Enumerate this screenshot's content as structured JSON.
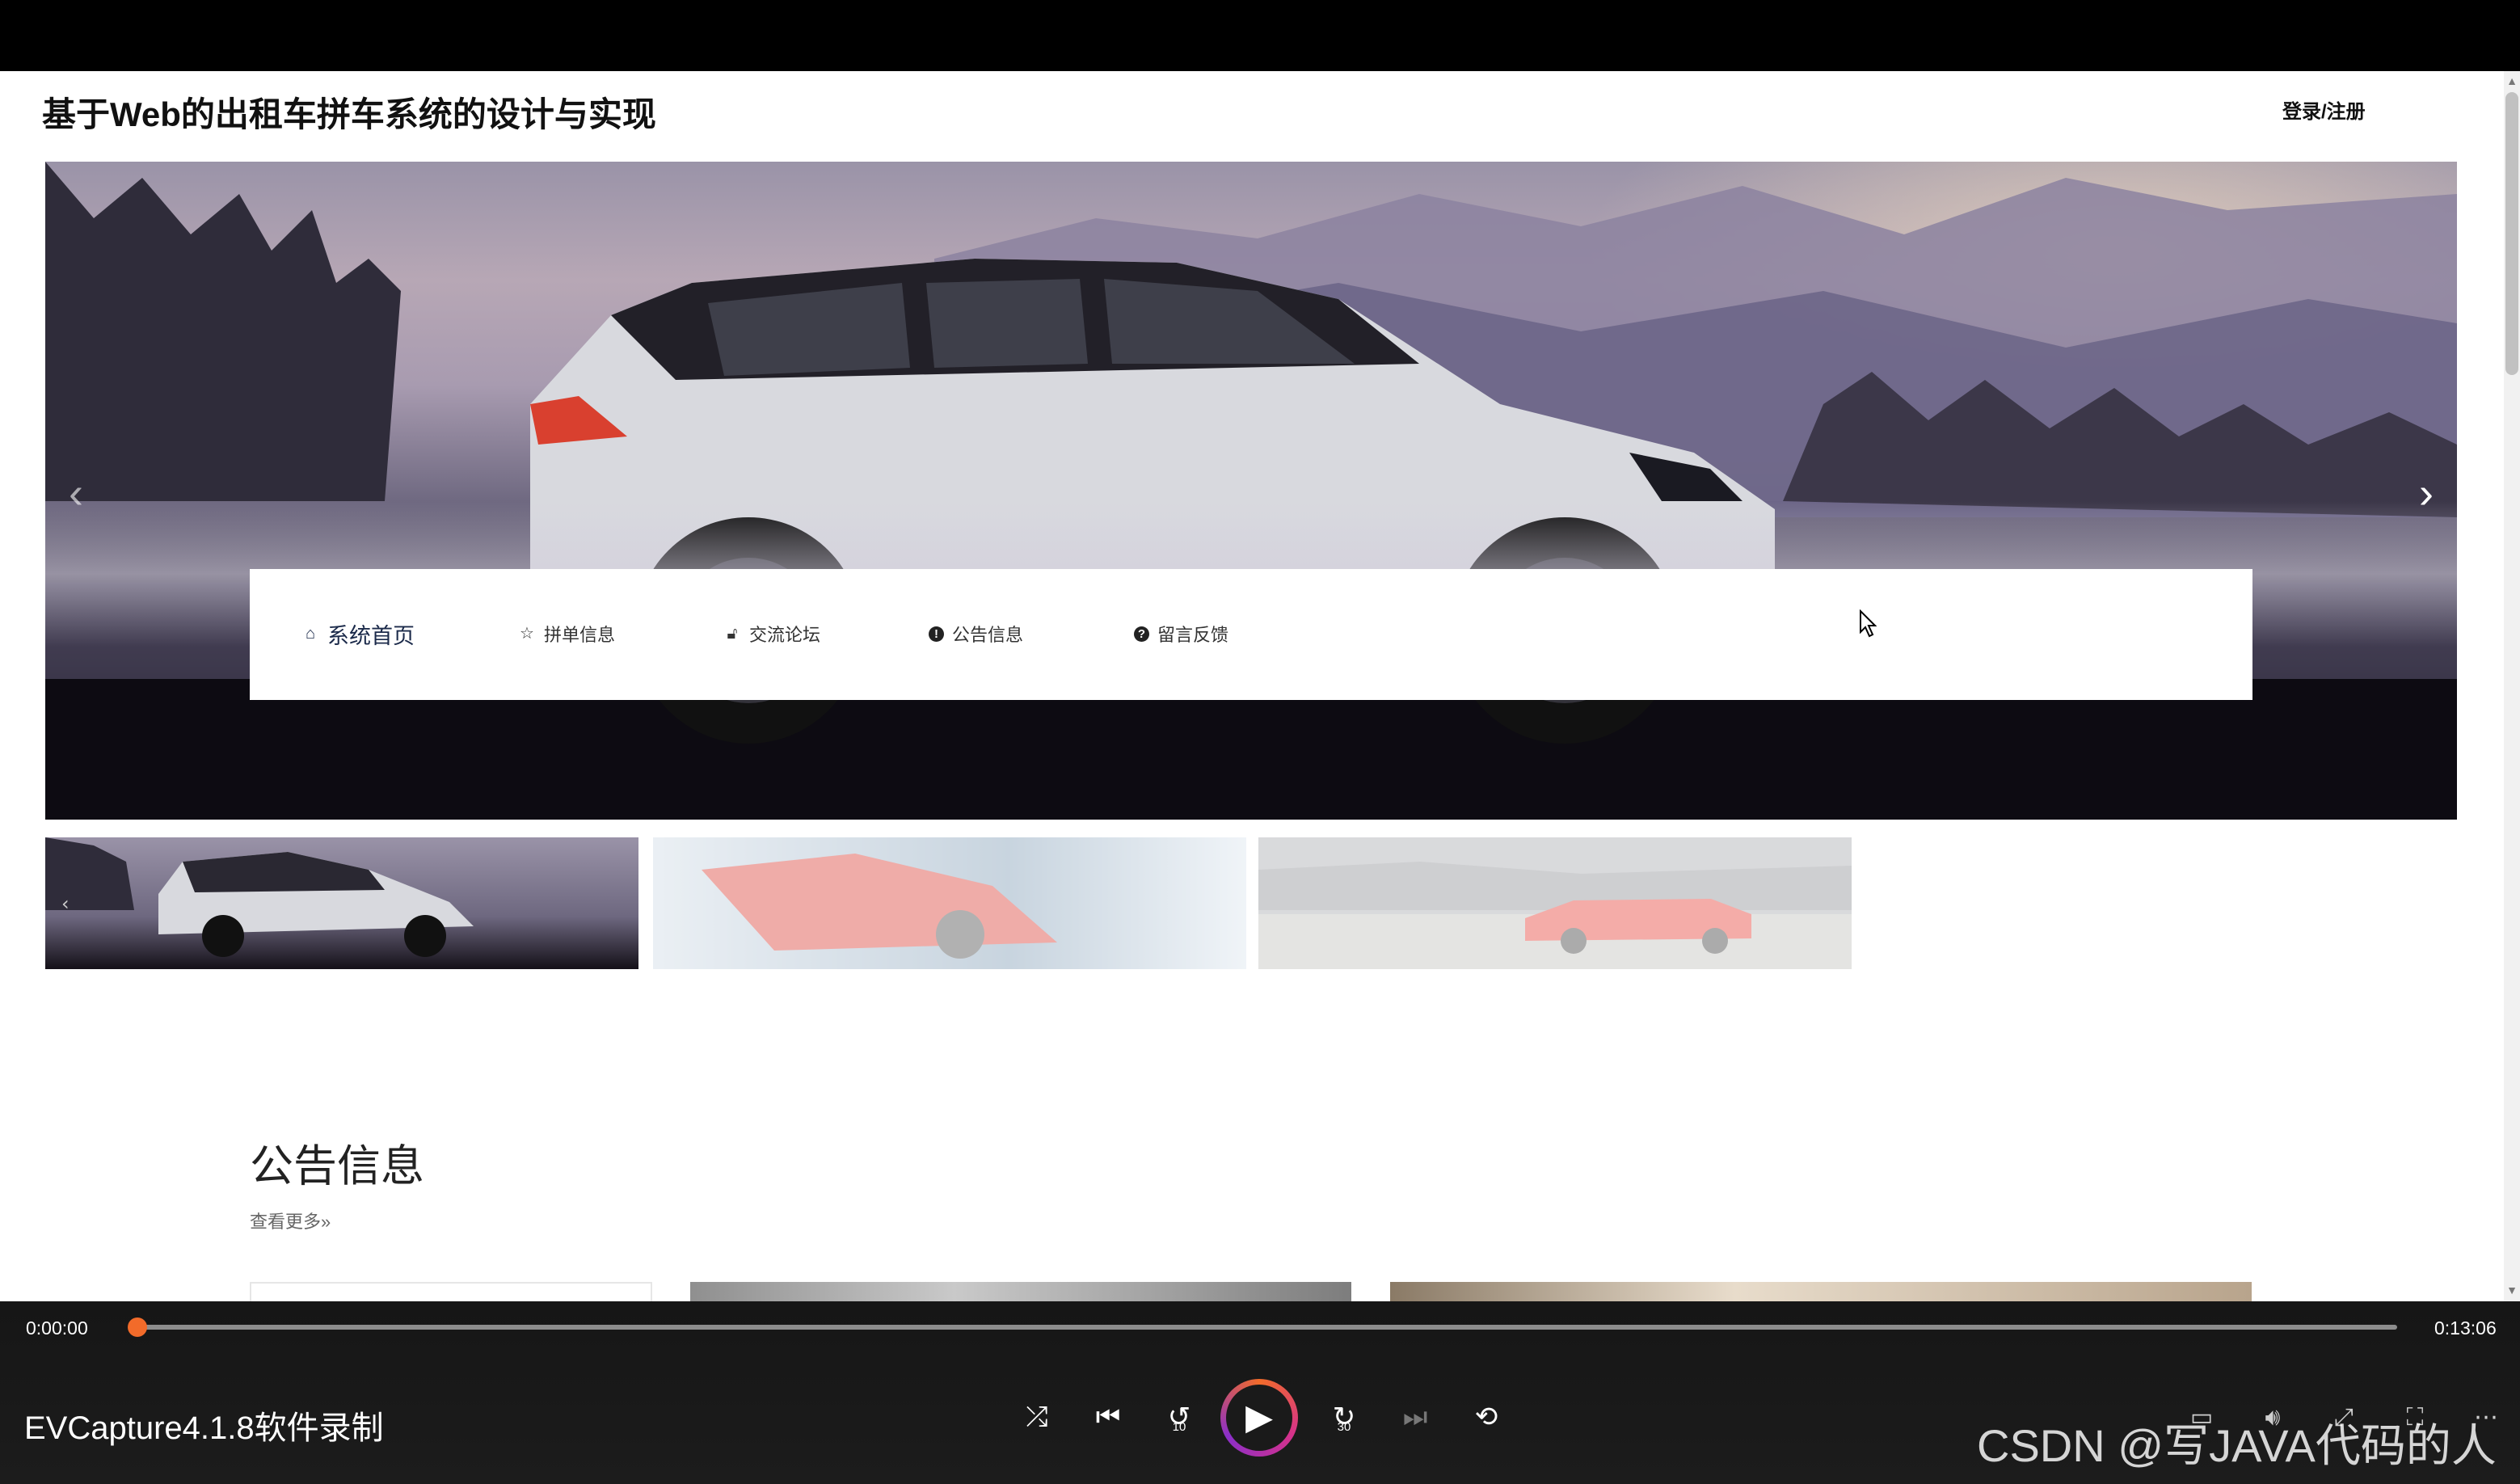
{
  "site": {
    "title": "基于Web的出租车拼车系统的设计与实现",
    "login_register": "登录/注册"
  },
  "hero": {
    "prev_icon": "chevron-left-icon",
    "next_icon": "chevron-right-icon",
    "thumbnails": [
      {
        "name": "white-suv",
        "active": true
      },
      {
        "name": "red-sports-car",
        "active": false
      },
      {
        "name": "red-coupe-track",
        "active": false
      }
    ]
  },
  "nav": {
    "items": [
      {
        "label": "系统首页",
        "icon": "home-icon",
        "active": true
      },
      {
        "label": "拼单信息",
        "icon": "star-icon",
        "active": false
      },
      {
        "label": "交流论坛",
        "icon": "lock-icon",
        "active": false
      },
      {
        "label": "公告信息",
        "icon": "exclamation-circle-icon",
        "active": false
      },
      {
        "label": "留言反馈",
        "icon": "question-circle-icon",
        "active": false
      }
    ]
  },
  "announcements": {
    "title": "公告信息",
    "more": "查看更多»"
  },
  "player": {
    "current_time": "0:00:00",
    "total_time": "0:13:06",
    "progress": 0.0,
    "label": "EVCapture4.1.8软件录制",
    "watermark": "CSDN @写JAVA代码的人",
    "controls": {
      "shuffle_icon": "shuffle-icon",
      "prev_icon": "skip-previous-icon",
      "rewind_label": "10",
      "play_icon": "play-icon",
      "forward_label": "30",
      "next_icon": "skip-next-icon",
      "repeat_icon": "repeat-off-icon"
    },
    "accent_color": "#f26b2a"
  }
}
